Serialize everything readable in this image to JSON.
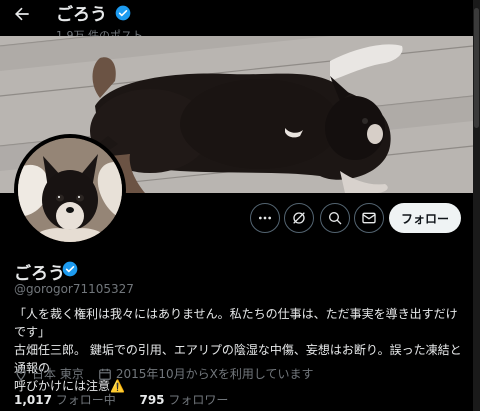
{
  "header": {
    "back_label": "←",
    "name": "ごろう",
    "post_count": "1.9万 件のポスト"
  },
  "actions": {
    "more": "more-icon",
    "grok": "grok-icon",
    "search": "search-icon",
    "message": "message-icon",
    "follow_label": "フォロー"
  },
  "profile": {
    "name": "ごろう",
    "handle": "@gorogor71105327",
    "bio": "「人を裁く権利は我々にはありません。私たちの仕事は、ただ事実を導き出すだけです」\n古畑任三郎。 鍵垢での引用、エアリプの陰湿な中傷、妄想はお断り。誤った凍結と通報の\n呼びかけには注意⚠️",
    "location": "日本 東京",
    "joined": "2015年10月からXを利用しています",
    "following_count": "1,017",
    "following_label": "フォロー中",
    "followers_count": "795",
    "followers_label": "フォロワー"
  },
  "colors": {
    "verified": "#1d9bf0",
    "background": "#000000",
    "secondary_text": "#71767b",
    "follow_button": "#eff3f4"
  }
}
